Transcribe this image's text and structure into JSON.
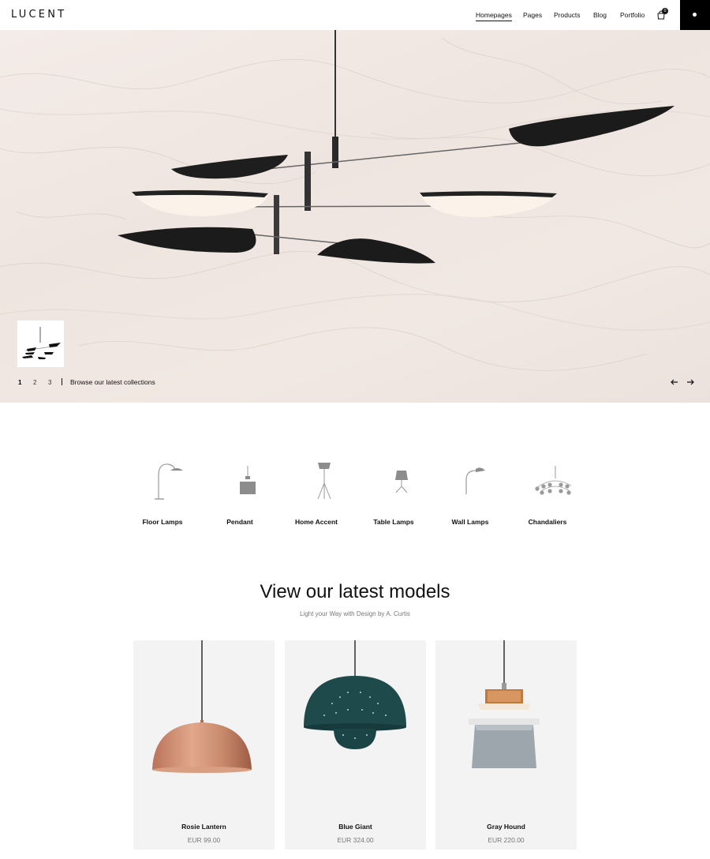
{
  "header": {
    "logo": "LUCENT",
    "nav": [
      "Homepages",
      "Pages",
      "Products",
      "Blog",
      "Portfolio"
    ],
    "cart_count": "0"
  },
  "hero": {
    "pages": [
      "1",
      "2",
      "3"
    ],
    "browse_text": "Browse our latest collections"
  },
  "categories": [
    "Floor Lamps",
    "Pendant",
    "Home Accent",
    "Table Lamps",
    "Wall Lamps",
    "Chandaliers"
  ],
  "section": {
    "title": "View our latest models",
    "subtitle": "Light your Way with Design by A. Curtis"
  },
  "products": [
    {
      "name": "Rosie Lantern",
      "price": "EUR 99.00"
    },
    {
      "name": "Blue Giant",
      "price": "EUR 324.00"
    },
    {
      "name": "Gray Hound",
      "price": "EUR 220.00"
    }
  ],
  "colors": {
    "hero_bg": "#f1e8e3",
    "card_bg": "#f3f3f3",
    "copper": "#c98a6c",
    "teal": "#1f4a4c",
    "accent_black": "#000000"
  }
}
